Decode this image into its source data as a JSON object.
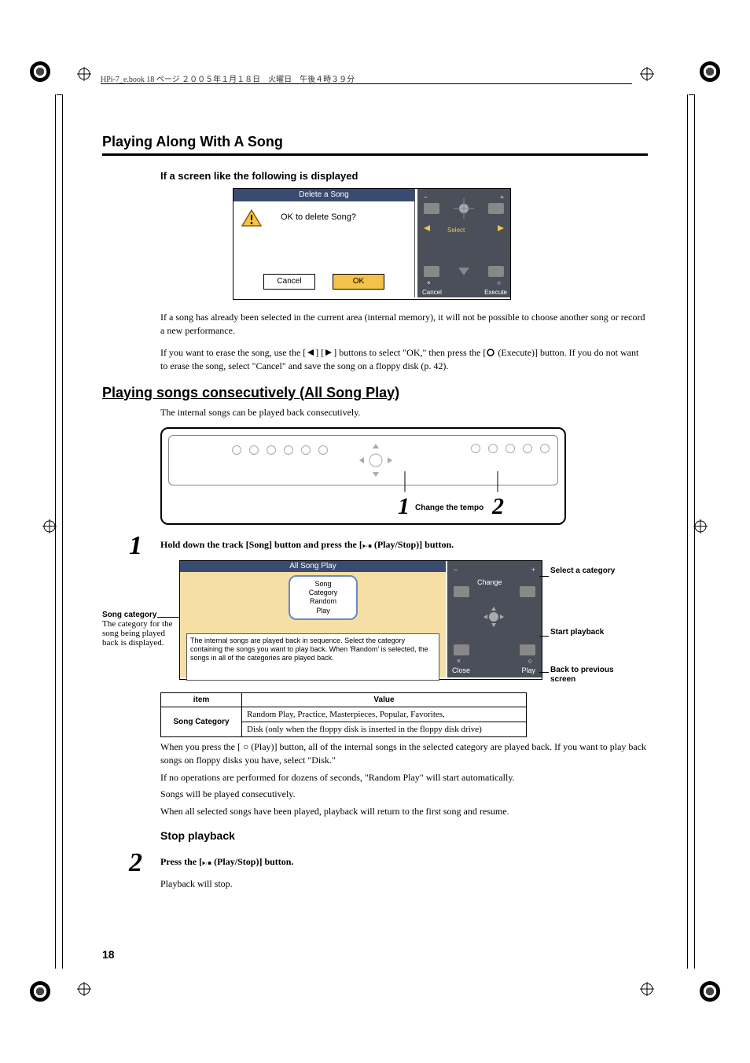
{
  "header_meta": "HPi-7_e.book 18 ページ ２００５年１月１８日　火曜日　午後４時３９分",
  "section_title": "Playing Along With A Song",
  "sub_heading": "If a screen like the following is displayed",
  "delete_dialog": {
    "title": "Delete a Song",
    "message": "OK to delete Song?",
    "cancel": "Cancel",
    "ok": "OK",
    "nav": {
      "minus": "−",
      "plus": "+",
      "select": "Select",
      "cancel": "Cancel",
      "execute": "Execute",
      "x": "×",
      "o": "○"
    }
  },
  "para1": "If a song has already been selected in the current area (internal memory), it will not be possible to choose another song or record a new performance.",
  "para2_a": "If you want to erase the song, use the [",
  "para2_b": "] [",
  "para2_c": "] buttons to select \"OK,\" then press the [",
  "para2_d": " (Execute)] button. If you do not want to erase the song, select \"Cancel\" and save the song on a floppy disk (p. 42).",
  "big_heading": "Playing songs consecutively (All Song Play)",
  "para3": "The internal songs can be played back consecutively.",
  "panel_caption_1": "1",
  "panel_caption_text": "Change the tempo",
  "panel_caption_2": "2",
  "step1_num": "1",
  "step1_a": "Hold down the track [Song] button and press the [",
  "step1_b": " (Play/Stop)] button.",
  "side_left_title": "Song category",
  "side_left_text": "The category for the song being played back is displayed.",
  "allsong": {
    "title": "All Song Play",
    "bubble": "Song\nCategory\nRandom\nPlay",
    "msg": "The internal songs are played back in sequence. Select the category containing the songs you want to play back. When 'Random' is selected, the songs in all of the categories are played back.",
    "nav": {
      "change": "Change",
      "minus": "−",
      "plus": "+",
      "close": "Close",
      "play": "Play",
      "x": "×",
      "o": "○"
    }
  },
  "annot_select": "Select a category",
  "annot_start": "Start playback",
  "annot_back": "Back to previous screen",
  "table": {
    "h1": "item",
    "h2": "Value",
    "k": "Song Category",
    "v1": "Random Play, Practice, Masterpieces, Popular, Favorites,",
    "v2": "Disk (only when the floppy disk is inserted in the floppy disk drive)"
  },
  "para4": "When you press the [ ○ (Play)] button, all of the internal songs in the selected category are played back. If you want to play back songs on floppy disks you have, select \"Disk.\"",
  "para5": "If no operations are performed for dozens of seconds, \"Random Play\" will start automatically.",
  "para6": "Songs will be played consecutively.",
  "para7": "When all selected songs have been played, playback will return to the first song and resume.",
  "mini_heading": "Stop playback",
  "step2_num": "2",
  "step2_a": "Press the [",
  "step2_b": " (Play/Stop)] button.",
  "para8": "Playback will stop.",
  "page_number": "18"
}
